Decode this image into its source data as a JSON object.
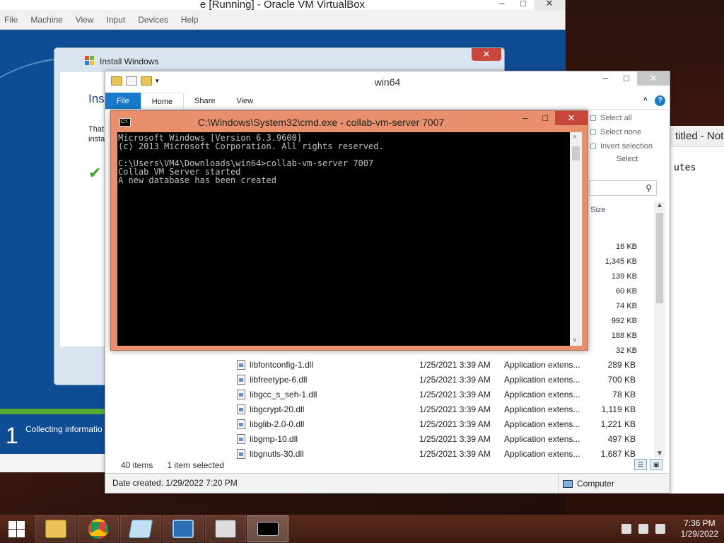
{
  "vbox": {
    "title": "e [Running] - Oracle VM VirtualBox",
    "menu": [
      "File",
      "Machine",
      "View",
      "Input",
      "Devices",
      "Help"
    ]
  },
  "install": {
    "title": "Install Windows",
    "heading": "Inst",
    "para_line1": "That",
    "para_line2": "insta",
    "step_number": "1",
    "step_text": "Collecting informatio"
  },
  "notepad": {
    "title": "titled - Not",
    "body": "utes"
  },
  "explorer": {
    "title": "win64",
    "tabs": [
      "File",
      "Home",
      "Share",
      "View"
    ],
    "ribbon_select": {
      "select_all": "Select all",
      "select_none": "Select none",
      "invert_selection": "Invert selection",
      "group_label": "Select"
    },
    "column_size": "Size",
    "partial_sizes": [
      "16 KB",
      "1,345 KB",
      "139 KB",
      "60 KB",
      "74 KB",
      "992 KB",
      "188 KB",
      "32 KB"
    ],
    "files": [
      {
        "name": "libfontconfig-1.dll",
        "date": "1/25/2021 3:39 AM",
        "type": "Application extens...",
        "size": "289 KB"
      },
      {
        "name": "libfreetype-6.dll",
        "date": "1/25/2021 3:39 AM",
        "type": "Application extens...",
        "size": "700 KB"
      },
      {
        "name": "libgcc_s_seh-1.dll",
        "date": "1/25/2021 3:39 AM",
        "type": "Application extens...",
        "size": "78 KB"
      },
      {
        "name": "libgcrypt-20.dll",
        "date": "1/25/2021 3:39 AM",
        "type": "Application extens...",
        "size": "1,119 KB"
      },
      {
        "name": "libglib-2.0-0.dll",
        "date": "1/25/2021 3:39 AM",
        "type": "Application extens...",
        "size": "1,221 KB"
      },
      {
        "name": "libgmp-10.dll",
        "date": "1/25/2021 3:39 AM",
        "type": "Application extens...",
        "size": "497 KB"
      },
      {
        "name": "libgnutls-30.dll",
        "date": "1/25/2021 3:39 AM",
        "type": "Application extens...",
        "size": "1,687 KB"
      }
    ],
    "status_items": "40 items",
    "status_selected": "1 item selected",
    "details": "Date created: 1/29/2022 7:20 PM",
    "location": "Computer"
  },
  "cmd": {
    "title": "C:\\Windows\\System32\\cmd.exe - collab-vm-server  7007",
    "lines": [
      "Microsoft Windows [Version 6.3.9600]",
      "(c) 2013 Microsoft Corporation. All rights reserved.",
      "",
      "C:\\Users\\VM4\\Downloads\\win64>collab-vm-server 7007",
      "Collab VM Server started",
      "A new database has been created"
    ]
  },
  "taskbar": {
    "time": "7:36 PM",
    "date": "1/29/2022"
  }
}
